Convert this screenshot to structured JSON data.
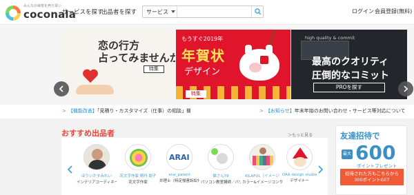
{
  "header": {
    "logo_tagline": "みんなの得意を売り買い",
    "logo_text": "coconala",
    "nav_find_service": "サービスを探す",
    "nav_find_seller": "出品者を探す",
    "search": {
      "category": "サービス",
      "placeholder": ""
    },
    "login": "ログイン",
    "register": "会員登録(無料)"
  },
  "carousel": {
    "slide1": {
      "line1": "恋の行方",
      "line2": "占ってみませんか？",
      "tag": "特集"
    },
    "slide2": {
      "small": "もうすぐ2019年",
      "big": "年賀状",
      "sub": "デザイン",
      "tag": "特集"
    },
    "slide3": {
      "hq": "high quality & commit",
      "line1": "最高のクオリティ",
      "line2": "圧倒的なコミット",
      "button": "PROを探す"
    }
  },
  "news": {
    "item1": {
      "label": "【機能改善】",
      "text": "「見積り・カスタマイズ（仕事）の相談」機能がより便利になりました！"
    },
    "item2": {
      "label": "【お知らせ】",
      "text": "年末年始のお問い合わせ・サービス等対応について"
    },
    "active_dot": 1
  },
  "recommend": {
    "title": "おすすめ出品者",
    "more": "＞もっと見る",
    "sellers": [
      {
        "name": "ほりいかすみれい",
        "role": "インテリアコーディネーター"
      },
      {
        "name": "花文字作家 桐丹 朋子",
        "role": "花文字作家"
      },
      {
        "name": "arai_patent",
        "role": "弁理士（特定侵害訴訟代理人）"
      },
      {
        "name": "猫さん78",
        "role": "パソコン教室講師／パソコン修理"
      },
      {
        "name": "KILAFUL（イメージ",
        "role": "カラー&イメージコンサルタント"
      },
      {
        "name": "OAA design studio",
        "role": "デザイナー"
      }
    ]
  },
  "invite": {
    "title": "友達招待で",
    "max": "最大",
    "amount": "600",
    "points": "ポイントプレゼント",
    "cta_line1": "招待された方もこちらから",
    "cta_line2": "300ポイントGET"
  },
  "colors": {
    "accent": "#e8463a",
    "link": "#4aa1d8",
    "invite_blue": "#3a8fc4",
    "cta_orange": "#f05a37",
    "carousel_red": "#e0142b"
  }
}
